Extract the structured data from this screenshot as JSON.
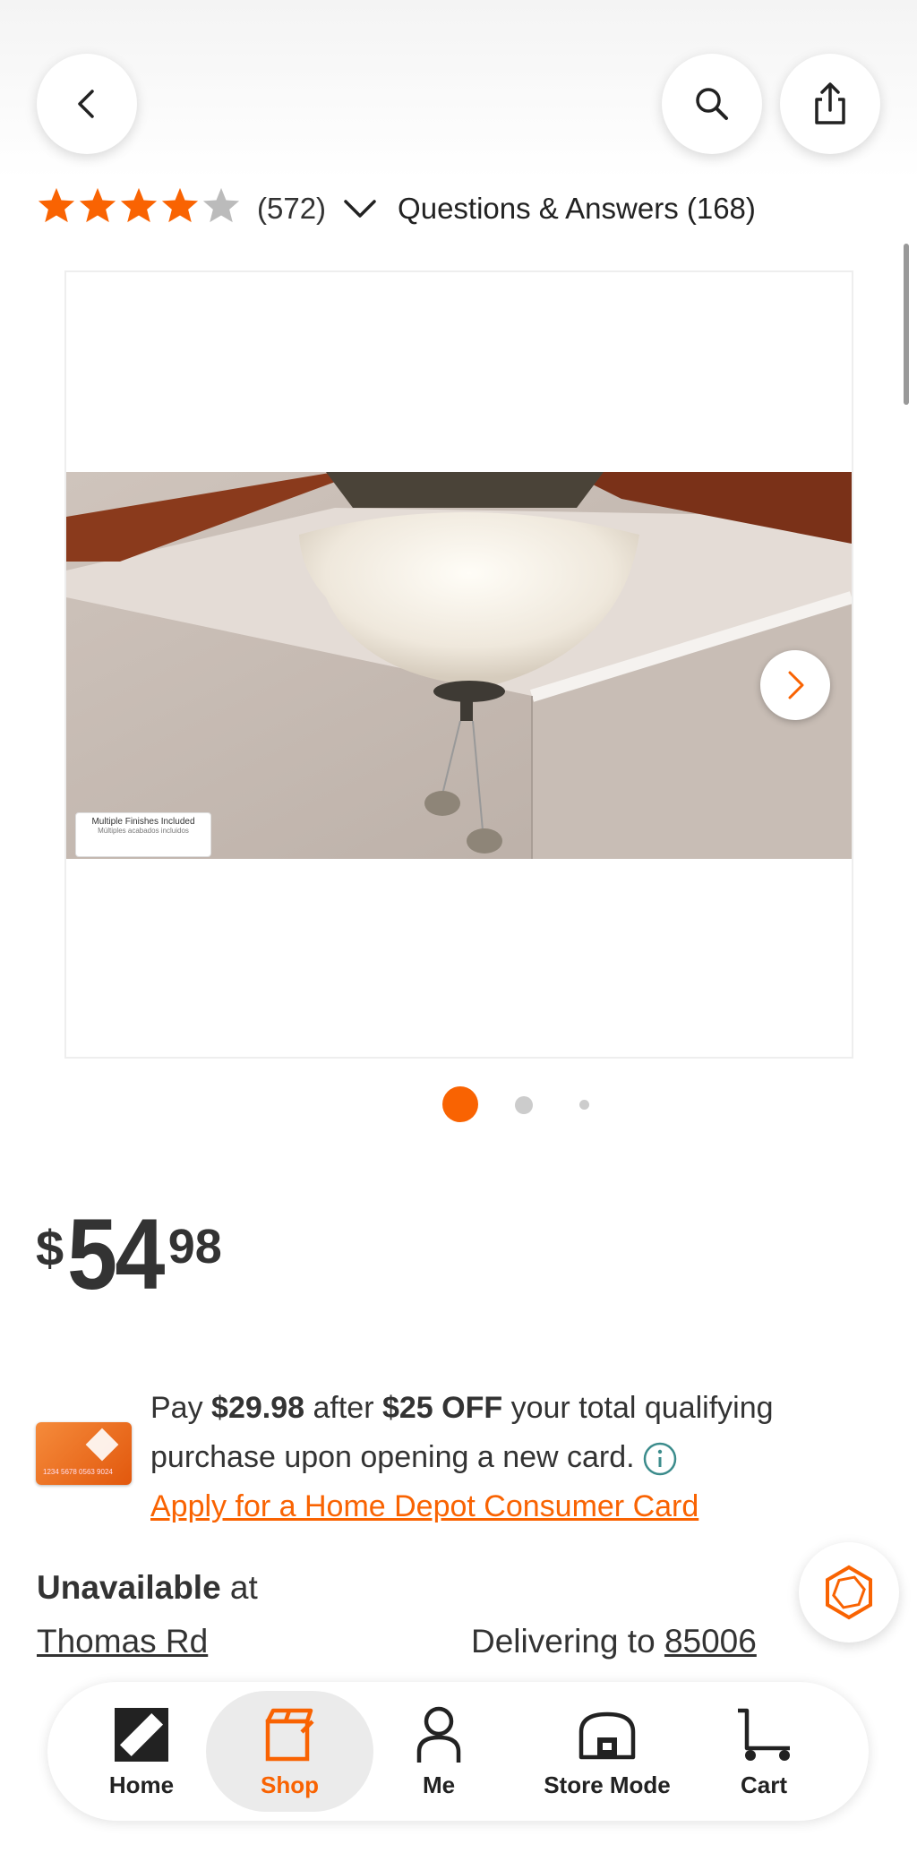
{
  "header": {
    "back": "chevron-left-icon",
    "search": "search-icon",
    "share": "share-icon"
  },
  "rating": {
    "stars": 4,
    "count": "(572)",
    "qa_label": "Questions & Answers (168)"
  },
  "gallery": {
    "badge_title": "Multiple Finishes Included",
    "badge_sub": "Múltiples acabados incluidos",
    "current_index": 1,
    "total": 3
  },
  "price": {
    "currency": "$",
    "dollars": "54",
    "cents": "98"
  },
  "promo": {
    "pay_prefix": "Pay ",
    "pay_amount": "$29.98",
    "after": " after ",
    "off_amount": "$25 OFF",
    "rest": " your total qualifying purchase upon opening a new card.",
    "apply_link": "Apply for a Home Depot Consumer Card",
    "card_number": "1234 5678 0563 9024"
  },
  "availability": {
    "status": "Unavailable",
    "at": " at",
    "store": "Thomas Rd",
    "delivering_label": "Delivering to ",
    "zip": "85006"
  },
  "tabs": {
    "home": "Home",
    "shop": "Shop",
    "me": "Me",
    "store_mode": "Store Mode",
    "cart": "Cart"
  },
  "colors": {
    "brand_orange": "#f96302",
    "star_empty": "#bbbbbb",
    "info_teal": "#3c8c8c"
  }
}
